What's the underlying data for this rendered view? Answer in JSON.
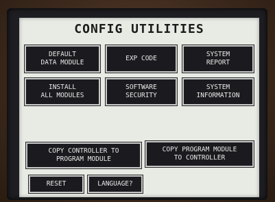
{
  "screen": {
    "title": "CONFIG UTILITIES"
  },
  "buttons": {
    "default_data_module": "DEFAULT\nDATA MODULE",
    "exp_code": "EXP CODE",
    "system_report": "SYSTEM\nREPORT",
    "install_all_modules": "INSTALL\nALL MODULES",
    "software_security": "SOFTWARE\nSECURITY",
    "system_information": "SYSTEM\nINFORMATION",
    "copy_controller_to_program_module": "COPY CONTROLLER TO\nPROGRAM MODULE",
    "copy_program_module_to_controller": "COPY PROGRAM MODULE\nTO CONTROLLER",
    "reset": "RESET",
    "language": "LANGUAGE?"
  },
  "colors": {
    "screen_background": "#e8eae4",
    "button_background": "#1b1b1f",
    "button_text": "#e9e9e9",
    "bezel": "#3e2a1d"
  }
}
